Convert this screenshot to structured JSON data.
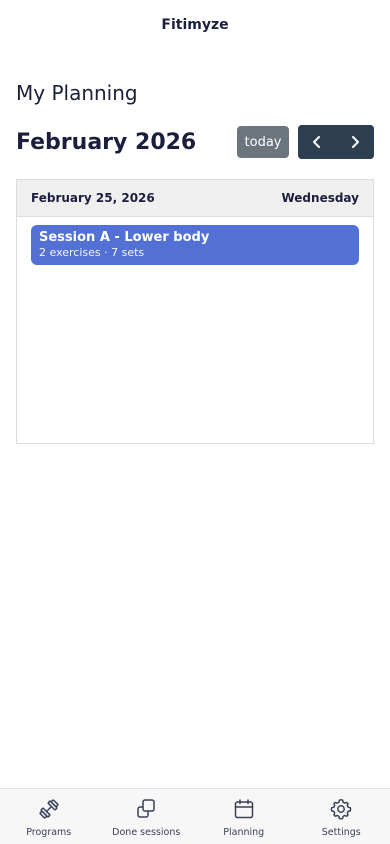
{
  "app": {
    "title": "Fitimyze"
  },
  "page": {
    "title": "My Planning"
  },
  "calendar": {
    "month_title": "February 2026",
    "today_label": "today",
    "prev_icon": "chevron-left-icon",
    "next_icon": "chevron-right-icon",
    "day": {
      "date": "February 25, 2026",
      "weekday": "Wednesday",
      "events": [
        {
          "title": "Session A - Lower body",
          "subtitle": "2 exercises · 7 sets",
          "color": "#5370d4"
        }
      ]
    }
  },
  "tabs": [
    {
      "label": "Programs",
      "icon": "dumbbell-icon"
    },
    {
      "label": "Done sessions",
      "icon": "copy-icon"
    },
    {
      "label": "Planning",
      "icon": "calendar-icon"
    },
    {
      "label": "Settings",
      "icon": "gear-icon"
    }
  ],
  "colors": {
    "primary_text": "#1b1f3b",
    "today_button": "#6c757d",
    "nav_button": "#2c3e50",
    "event": "#5370d4"
  }
}
